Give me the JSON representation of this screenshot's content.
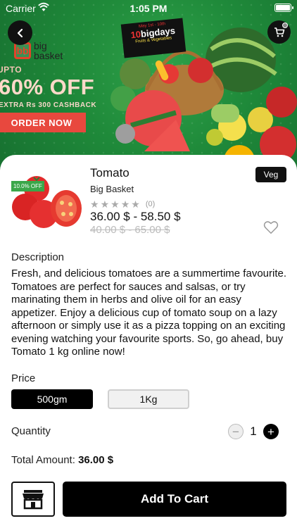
{
  "status_bar": {
    "carrier": "Carrier",
    "time": "1:05 PM"
  },
  "banner": {
    "logo_mark": "bb",
    "logo_text_line1": "big",
    "logo_text_line2": "basket",
    "promo_upto": "UPTO",
    "promo_off": "60% OFF",
    "promo_cashback": "EXTRA Rs 300 CASHBACK",
    "order_now": "ORDER NOW",
    "badge_dates": "May 1st - 10th",
    "badge_title_num": "10",
    "badge_title_word": "bigdays",
    "badge_sub": "Fruits & Vegetables"
  },
  "product": {
    "title": "Tomato",
    "brand": "Big Basket",
    "discount_badge": "10.0% OFF",
    "rating_count": "(0)",
    "price": "36.00 $ - 58.50 $",
    "old_price": "40.00 $ - 65.00 $",
    "veg_tag": "Veg"
  },
  "description": {
    "label": "Description",
    "text": "Fresh, and delicious tomatoes are a summertime favourite. Tomatoes are perfect for sauces and salsas, or try marinating them in herbs and olive oil for an easy appetizer. Enjoy a delicious cup of tomato soup on a lazy afternoon or simply use it as a pizza topping on an exciting evening watching your favourite sports. So, go ahead, buy Tomato 1 kg online now!"
  },
  "price_options": {
    "label": "Price",
    "options": [
      "500gm",
      "1Kg"
    ],
    "selected": "500gm"
  },
  "quantity": {
    "label": "Quantity",
    "value": "1",
    "minus": "−",
    "plus": "+"
  },
  "total": {
    "label": "Total Amount:",
    "amount": "36.00 $"
  },
  "actions": {
    "add_to_cart": "Add To Cart"
  },
  "colors": {
    "accent": "#000000",
    "badge_green": "#3ba74a",
    "banner_green": "#1f8a3a"
  }
}
